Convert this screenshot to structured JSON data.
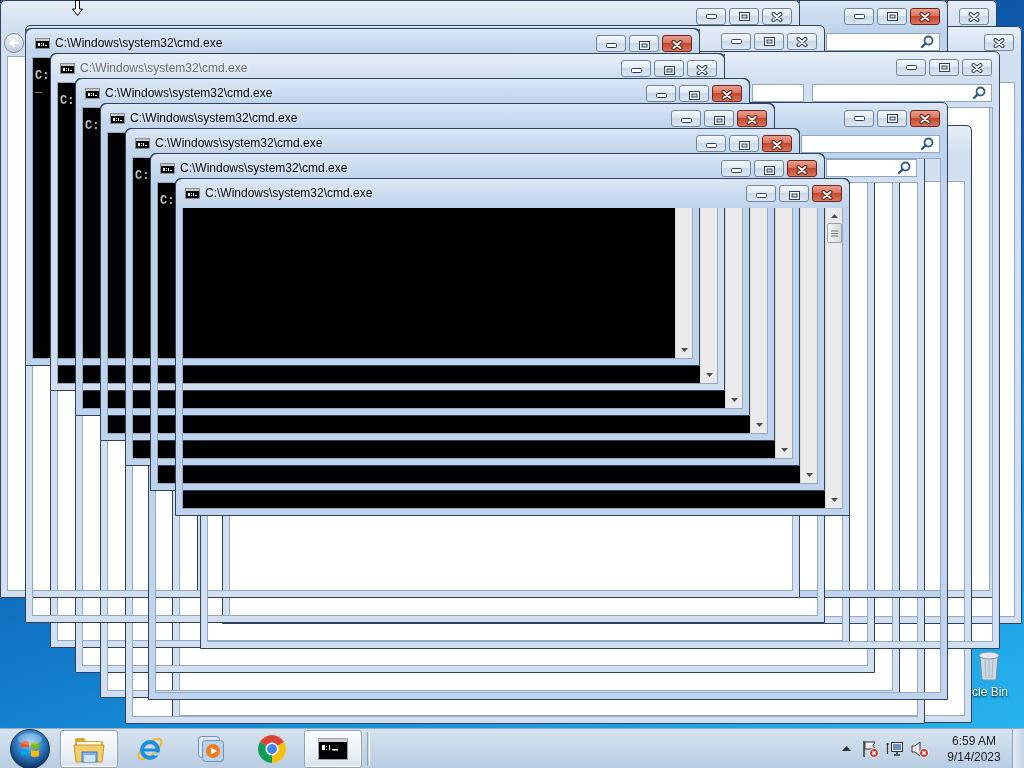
{
  "explorer_windows": [
    {
      "active": false
    },
    {
      "active": true
    },
    {
      "active": false
    },
    {
      "active": false
    },
    {
      "active": false
    },
    {
      "active": false
    },
    {
      "active": true
    }
  ],
  "console_windows": [
    {
      "title": "C:\\Windows\\system32\\cmd.exe",
      "active": true,
      "lines": [
        "C:",
        "_"
      ]
    },
    {
      "title": "C:\\Windows\\system32\\cmd.exe",
      "active": false,
      "lines": [
        "C:"
      ]
    },
    {
      "title": "C:\\Windows\\system32\\cmd.exe",
      "active": true,
      "lines": [
        "C:"
      ]
    },
    {
      "title": "C:\\Windows\\system32\\cmd.exe",
      "active": true
    },
    {
      "title": "C:\\Windows\\system32\\cmd.exe",
      "active": true,
      "lines": [
        "C:"
      ]
    },
    {
      "title": "C:\\Windows\\system32\\cmd.exe",
      "active": true,
      "lines": [
        "C:"
      ]
    },
    {
      "title": "C:\\Windows\\system32\\cmd.exe",
      "active": true
    }
  ],
  "desktop_icons": [
    {
      "label": "cle Bin"
    }
  ],
  "taskbar": {
    "items": [
      {
        "kind": "folder",
        "running": true
      },
      {
        "kind": "ie",
        "running": false
      },
      {
        "kind": "player",
        "running": false
      },
      {
        "kind": "chrome",
        "running": false
      },
      {
        "kind": "console",
        "running": true
      }
    ],
    "tray_icons": [
      {
        "kind": "flag",
        "alert": true
      },
      {
        "kind": "network",
        "alert": false
      },
      {
        "kind": "volume",
        "alert": true
      }
    ],
    "clock": {
      "time": "6:59 AM",
      "date": "9/14/2023"
    }
  }
}
